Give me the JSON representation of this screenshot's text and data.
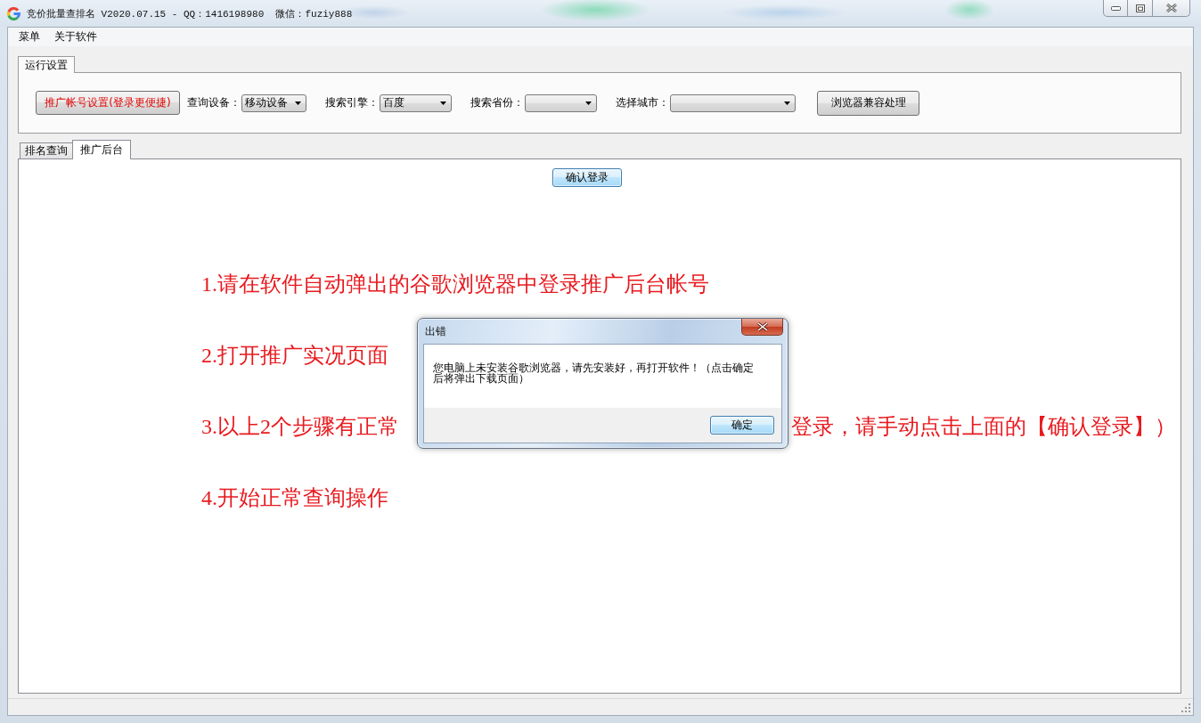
{
  "window": {
    "title": "竞价批量查排名 V2020.07.15 - QQ：1416198980  微信：fuziy888"
  },
  "menu": [
    {
      "label": "菜单"
    },
    {
      "label": "关于软件"
    }
  ],
  "settings": {
    "tab": "运行设置",
    "account_button": "推广帐号设置(登录更便捷)",
    "fields": [
      {
        "label": "查询设备：",
        "value": "移动设备"
      },
      {
        "label": "搜索引擎：",
        "value": "百度"
      },
      {
        "label": "搜索省份："
      },
      {
        "label": "选择城市："
      }
    ],
    "compat_button": "浏览器兼容处理"
  },
  "tabs": [
    {
      "label": "排名查询",
      "selected": false
    },
    {
      "label": "推广后台",
      "selected": true
    }
  ],
  "login_tab": {
    "confirm_button": "确认登录",
    "instructions": [
      {
        "segments": [
          "1.请在软件自动弹出的谷歌浏览器中登录推广后台帐号"
        ]
      },
      {
        "segments": [
          "2.打开推广实况页面"
        ]
      },
      {
        "segments": [
          "3.以上2个步骤有正常",
          "登录，请手动点击上面的【确认登录】）"
        ]
      },
      {
        "segments": [
          "4.开始正常查询操作"
        ]
      }
    ]
  },
  "dialog": {
    "title": "出错",
    "message": "您电脑上未安装谷歌浏览器，请先安装好，再打开软件！（点击确定后将弹出下载页面）",
    "ok_button": "确定"
  }
}
